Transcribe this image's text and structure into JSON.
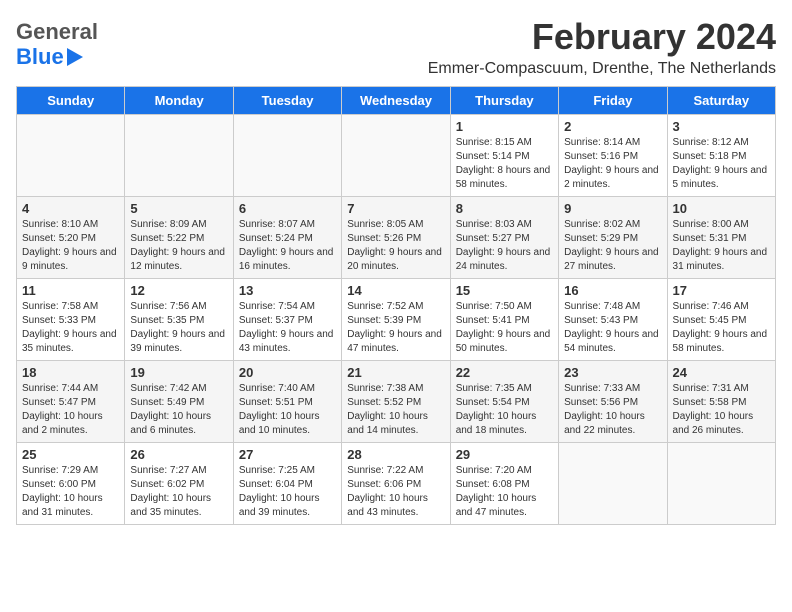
{
  "header": {
    "logo_line1": "General",
    "logo_line2": "Blue",
    "title": "February 2024",
    "subtitle": "Emmer-Compascuum, Drenthe, The Netherlands"
  },
  "weekdays": [
    "Sunday",
    "Monday",
    "Tuesday",
    "Wednesday",
    "Thursday",
    "Friday",
    "Saturday"
  ],
  "weeks": [
    [
      {
        "day": "",
        "info": ""
      },
      {
        "day": "",
        "info": ""
      },
      {
        "day": "",
        "info": ""
      },
      {
        "day": "",
        "info": ""
      },
      {
        "day": "1",
        "info": "Sunrise: 8:15 AM\nSunset: 5:14 PM\nDaylight: 8 hours and 58 minutes."
      },
      {
        "day": "2",
        "info": "Sunrise: 8:14 AM\nSunset: 5:16 PM\nDaylight: 9 hours and 2 minutes."
      },
      {
        "day": "3",
        "info": "Sunrise: 8:12 AM\nSunset: 5:18 PM\nDaylight: 9 hours and 5 minutes."
      }
    ],
    [
      {
        "day": "4",
        "info": "Sunrise: 8:10 AM\nSunset: 5:20 PM\nDaylight: 9 hours and 9 minutes."
      },
      {
        "day": "5",
        "info": "Sunrise: 8:09 AM\nSunset: 5:22 PM\nDaylight: 9 hours and 12 minutes."
      },
      {
        "day": "6",
        "info": "Sunrise: 8:07 AM\nSunset: 5:24 PM\nDaylight: 9 hours and 16 minutes."
      },
      {
        "day": "7",
        "info": "Sunrise: 8:05 AM\nSunset: 5:26 PM\nDaylight: 9 hours and 20 minutes."
      },
      {
        "day": "8",
        "info": "Sunrise: 8:03 AM\nSunset: 5:27 PM\nDaylight: 9 hours and 24 minutes."
      },
      {
        "day": "9",
        "info": "Sunrise: 8:02 AM\nSunset: 5:29 PM\nDaylight: 9 hours and 27 minutes."
      },
      {
        "day": "10",
        "info": "Sunrise: 8:00 AM\nSunset: 5:31 PM\nDaylight: 9 hours and 31 minutes."
      }
    ],
    [
      {
        "day": "11",
        "info": "Sunrise: 7:58 AM\nSunset: 5:33 PM\nDaylight: 9 hours and 35 minutes."
      },
      {
        "day": "12",
        "info": "Sunrise: 7:56 AM\nSunset: 5:35 PM\nDaylight: 9 hours and 39 minutes."
      },
      {
        "day": "13",
        "info": "Sunrise: 7:54 AM\nSunset: 5:37 PM\nDaylight: 9 hours and 43 minutes."
      },
      {
        "day": "14",
        "info": "Sunrise: 7:52 AM\nSunset: 5:39 PM\nDaylight: 9 hours and 47 minutes."
      },
      {
        "day": "15",
        "info": "Sunrise: 7:50 AM\nSunset: 5:41 PM\nDaylight: 9 hours and 50 minutes."
      },
      {
        "day": "16",
        "info": "Sunrise: 7:48 AM\nSunset: 5:43 PM\nDaylight: 9 hours and 54 minutes."
      },
      {
        "day": "17",
        "info": "Sunrise: 7:46 AM\nSunset: 5:45 PM\nDaylight: 9 hours and 58 minutes."
      }
    ],
    [
      {
        "day": "18",
        "info": "Sunrise: 7:44 AM\nSunset: 5:47 PM\nDaylight: 10 hours and 2 minutes."
      },
      {
        "day": "19",
        "info": "Sunrise: 7:42 AM\nSunset: 5:49 PM\nDaylight: 10 hours and 6 minutes."
      },
      {
        "day": "20",
        "info": "Sunrise: 7:40 AM\nSunset: 5:51 PM\nDaylight: 10 hours and 10 minutes."
      },
      {
        "day": "21",
        "info": "Sunrise: 7:38 AM\nSunset: 5:52 PM\nDaylight: 10 hours and 14 minutes."
      },
      {
        "day": "22",
        "info": "Sunrise: 7:35 AM\nSunset: 5:54 PM\nDaylight: 10 hours and 18 minutes."
      },
      {
        "day": "23",
        "info": "Sunrise: 7:33 AM\nSunset: 5:56 PM\nDaylight: 10 hours and 22 minutes."
      },
      {
        "day": "24",
        "info": "Sunrise: 7:31 AM\nSunset: 5:58 PM\nDaylight: 10 hours and 26 minutes."
      }
    ],
    [
      {
        "day": "25",
        "info": "Sunrise: 7:29 AM\nSunset: 6:00 PM\nDaylight: 10 hours and 31 minutes."
      },
      {
        "day": "26",
        "info": "Sunrise: 7:27 AM\nSunset: 6:02 PM\nDaylight: 10 hours and 35 minutes."
      },
      {
        "day": "27",
        "info": "Sunrise: 7:25 AM\nSunset: 6:04 PM\nDaylight: 10 hours and 39 minutes."
      },
      {
        "day": "28",
        "info": "Sunrise: 7:22 AM\nSunset: 6:06 PM\nDaylight: 10 hours and 43 minutes."
      },
      {
        "day": "29",
        "info": "Sunrise: 7:20 AM\nSunset: 6:08 PM\nDaylight: 10 hours and 47 minutes."
      },
      {
        "day": "",
        "info": ""
      },
      {
        "day": "",
        "info": ""
      }
    ]
  ]
}
